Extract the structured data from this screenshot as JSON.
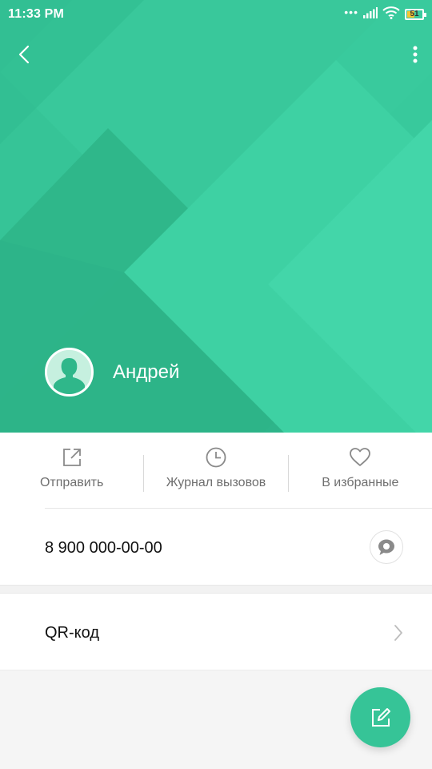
{
  "status_bar": {
    "time": "11:33 PM",
    "dots": "•••",
    "battery_level": "51",
    "battery_fraction": 0.51,
    "icons": [
      "signal-icon",
      "wifi-icon",
      "battery-icon"
    ]
  },
  "header": {
    "background_color": "#36c497",
    "back_icon": "back-arrow-icon",
    "more_icon": "more-vertical-icon"
  },
  "contact": {
    "name": "Андрей",
    "avatar_icon": "default-avatar-icon"
  },
  "actions": [
    {
      "label": "Отправить",
      "icon": "share-icon"
    },
    {
      "label": "Журнал вызовов",
      "icon": "clock-icon"
    },
    {
      "label": "В избранные",
      "icon": "heart-icon"
    }
  ],
  "phone": {
    "number": "8 900 000-00-00",
    "message_icon": "message-icon"
  },
  "qr": {
    "label": "QR-код",
    "chevron_icon": "chevron-right-icon"
  },
  "fab": {
    "icon": "edit-icon",
    "color": "#36c497"
  }
}
